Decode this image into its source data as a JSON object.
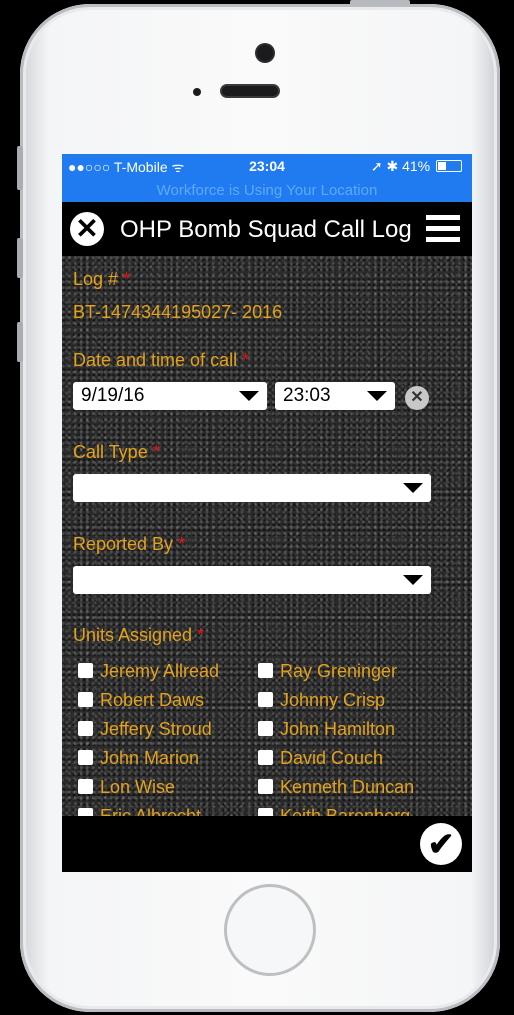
{
  "status_bar": {
    "carrier": "●●○○○ T-Mobile ᯤ",
    "time": "23:04",
    "battery": "➚ ✱ 41%",
    "battery_level": 0.41,
    "location_banner": "Workforce is Using Your Location"
  },
  "app_bar": {
    "title": "OHP Bomb Squad Call Log",
    "close_glyph": "✕",
    "close_icon": "close-icon",
    "menu_icon": "hamburger-menu-icon"
  },
  "form": {
    "log_label": "Log # ",
    "log_value": "BT-1474344195027- 2016",
    "date_label": "Date and time of call ",
    "date_value": "9/19/16",
    "time_value": "23:03",
    "clear_glyph": "✕",
    "call_type_label": "Call Type ",
    "call_type_value": "",
    "reported_by_label": "Reported By ",
    "reported_by_value": "",
    "units_label": "Units Assigned ",
    "required_mark": "*",
    "units_left": [
      "Jeremy Allread",
      "Robert Daws",
      "Jeffery Stroud",
      "John Marion",
      "Lon Wise",
      "Eric Albrecht"
    ],
    "units_right": [
      "Ray Greninger",
      "Johnny Crisp",
      "John Hamilton",
      "David Couch",
      "Kenneth Duncan",
      "Keith Barenberg"
    ]
  },
  "footer": {
    "confirm_glyph": "✔",
    "confirm_icon": "checkmark-icon"
  },
  "colors": {
    "status_bar": "#1f7bef",
    "label": "#e3a21a",
    "required": "#e11111"
  }
}
